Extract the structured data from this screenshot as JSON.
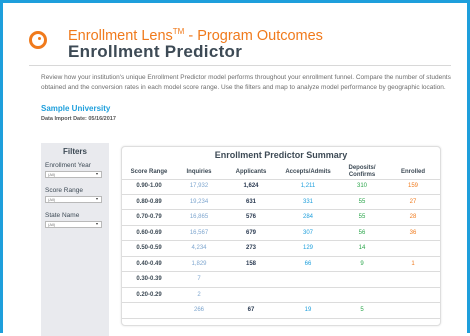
{
  "header": {
    "title_line1": "Enrollment Lens",
    "title_trademark": "TM",
    "title_line1_suffix": " - Program Outcomes",
    "title_line2": "Enrollment Predictor",
    "logo_icon": "enrollment-lens-logo-icon"
  },
  "description": "Review how your institution's unique Enrollment Predictor model performs throughout your enrollment funnel. Compare the number of students obtained and the conversion rates in each model score range. Use the filters and map to analyze model performance by geographic location.",
  "institution": {
    "name": "Sample University",
    "import_date": "Data Import Date: 05/16/2017"
  },
  "filters": {
    "title": "Filters",
    "items": [
      {
        "label": "Enrollment Year",
        "value": "(All)"
      },
      {
        "label": "Score Range",
        "value": "(All)"
      },
      {
        "label": "State Name",
        "value": "(All)"
      }
    ]
  },
  "summary": {
    "title": "Enrollment Predictor Summary",
    "columns": [
      "Score Range",
      "Inquiries",
      "Applicants",
      "Accepts/Admits",
      "Deposits/ Confirms",
      "Enrolled"
    ],
    "rows": [
      {
        "range": "0.90-1.00",
        "inquiries": "17,932",
        "applicants": "1,624",
        "accepts": "1,211",
        "deposits": "310",
        "enrolled": "159"
      },
      {
        "range": "0.80-0.89",
        "inquiries": "19,234",
        "applicants": "631",
        "accepts": "331",
        "deposits": "55",
        "enrolled": "27"
      },
      {
        "range": "0.70-0.79",
        "inquiries": "16,865",
        "applicants": "576",
        "accepts": "284",
        "deposits": "55",
        "enrolled": "28"
      },
      {
        "range": "0.60-0.69",
        "inquiries": "16,567",
        "applicants": "679",
        "accepts": "307",
        "deposits": "56",
        "enrolled": "36"
      },
      {
        "range": "0.50-0.59",
        "inquiries": "4,234",
        "applicants": "273",
        "accepts": "129",
        "deposits": "14",
        "enrolled": ""
      },
      {
        "range": "0.40-0.49",
        "inquiries": "1,829",
        "applicants": "158",
        "accepts": "66",
        "deposits": "9",
        "enrolled": "1"
      },
      {
        "range": "0.30-0.39",
        "inquiries": "7",
        "applicants": "",
        "accepts": "",
        "deposits": "",
        "enrolled": ""
      },
      {
        "range": "0.20-0.29",
        "inquiries": "2",
        "applicants": "",
        "accepts": "",
        "deposits": "",
        "enrolled": ""
      },
      {
        "range": "",
        "inquiries": "266",
        "applicants": "67",
        "accepts": "19",
        "deposits": "5",
        "enrolled": ""
      }
    ]
  },
  "colors": {
    "accent_blue": "#1e9fdc",
    "accent_orange": "#f07a1c",
    "deposit_green": "#2aa54a",
    "inquiry_blue": "#7ea6cf"
  }
}
